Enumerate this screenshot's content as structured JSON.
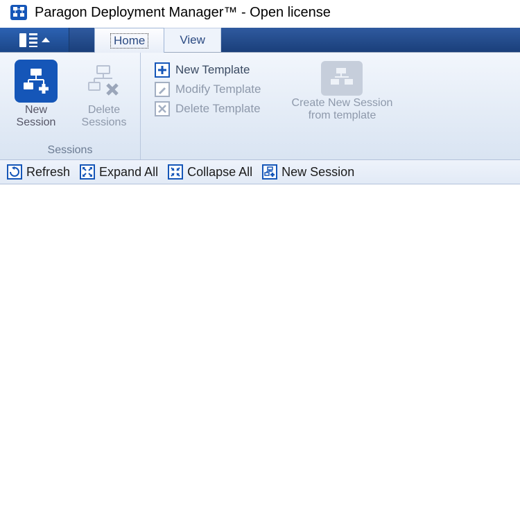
{
  "title": "Paragon Deployment Manager™ - Open license",
  "tabs": {
    "home": "Home",
    "view": "View"
  },
  "ribbon": {
    "sessions_group_label": "Sessions",
    "new_session": "New Session",
    "delete_sessions": "Delete Sessions",
    "new_template": "New Template",
    "modify_template": "Modify Template",
    "delete_template": "Delete Template",
    "create_from_template": "Create New Session from template"
  },
  "quickbar": {
    "refresh": "Refresh",
    "expand_all": "Expand All",
    "collapse_all": "Collapse All",
    "new_session": "New Session"
  }
}
